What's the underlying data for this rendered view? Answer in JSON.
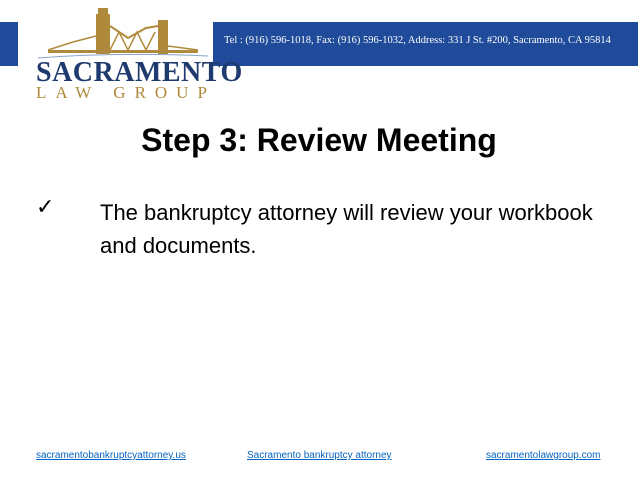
{
  "header": {
    "contact_line": "Tel : (916) 596-1018, Fax: (916) 596-1032, Address: 331 J St. #200, Sacramento, CA 95814",
    "logo": {
      "name_line1": "SACRAMENTO",
      "name_line2": "LAW GROUP"
    },
    "brand_colors": {
      "banner": "#1f4b9a",
      "navy": "#1f3a6e",
      "gold": "#b08a3c"
    }
  },
  "slide": {
    "title": "Step 3: Review Meeting",
    "bullets": [
      {
        "icon": "checkmark-icon",
        "text": "The bankruptcy attorney will review your workbook and documents."
      }
    ]
  },
  "footer": {
    "links": [
      {
        "label": "sacramentobankruptcyattorney.us"
      },
      {
        "label": "Sacramento bankruptcy attorney"
      },
      {
        "label": "sacramentolawgroup.com"
      }
    ]
  }
}
